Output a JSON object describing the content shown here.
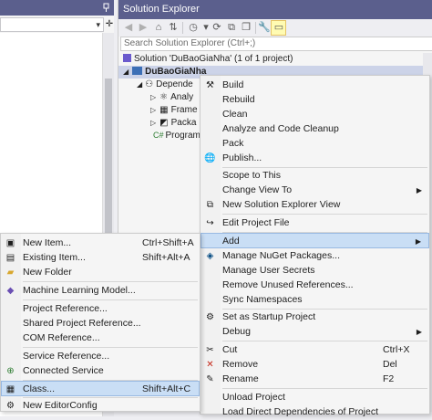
{
  "solution_explorer": {
    "title": "Solution Explorer",
    "search_placeholder": "Search Solution Explorer (Ctrl+;)",
    "tree": {
      "solution": "Solution 'DuBaoGiaNha' (1 of 1 project)",
      "project": "DuBaoGiaNha",
      "dependencies": "Depende",
      "analyzers": "Analy",
      "frameworks": "Frame",
      "packages": "Packa",
      "program": "Program."
    }
  },
  "context_menu": {
    "items": {
      "build": "Build",
      "rebuild": "Rebuild",
      "clean": "Clean",
      "analyze": "Analyze and Code Cleanup",
      "pack": "Pack",
      "publish": "Publish...",
      "scope": "Scope to This",
      "change_view": "Change View To",
      "new_view": "New Solution Explorer View",
      "edit_project": "Edit Project File",
      "add": "Add",
      "nuget": "Manage NuGet Packages...",
      "secrets": "Manage User Secrets",
      "remove_refs": "Remove Unused References...",
      "sync_ns": "Sync Namespaces",
      "startup": "Set as Startup Project",
      "debug": "Debug",
      "cut": "Cut",
      "remove": "Remove",
      "rename": "Rename",
      "unload": "Unload Project",
      "load_deps": "Load Direct Dependencies of Project"
    },
    "shortcuts": {
      "cut": "Ctrl+X",
      "remove": "Del",
      "rename": "F2"
    }
  },
  "add_submenu": {
    "items": {
      "new_item": "New Item...",
      "existing_item": "Existing Item...",
      "new_folder": "New Folder",
      "ml_model": "Machine Learning Model...",
      "project_ref": "Project Reference...",
      "shared_ref": "Shared Project Reference...",
      "com_ref": "COM Reference...",
      "service_ref": "Service Reference...",
      "connected_service": "Connected Service",
      "class": "Class...",
      "editorconfig": "New EditorConfig"
    },
    "shortcuts": {
      "new_item": "Ctrl+Shift+A",
      "existing_item": "Shift+Alt+A",
      "class": "Shift+Alt+C"
    }
  },
  "colors": {
    "title_bar": "#5b5f8d",
    "highlight": "#c9def5",
    "selection": "#ccd3e8"
  }
}
